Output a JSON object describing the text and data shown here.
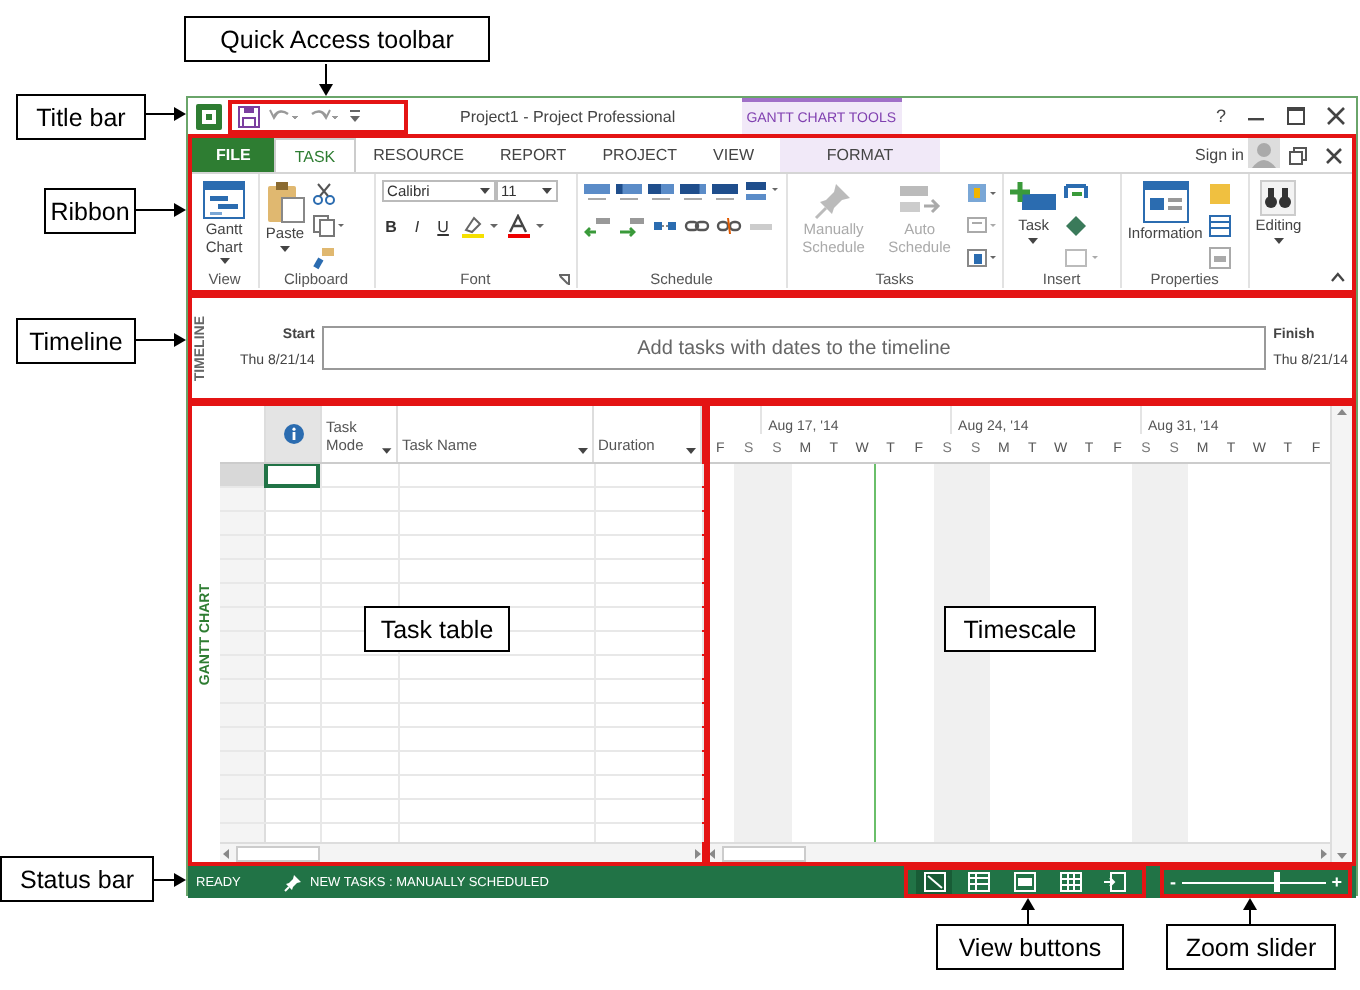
{
  "callouts": {
    "quick_access": "Quick Access toolbar",
    "title_bar": "Title bar",
    "ribbon": "Ribbon",
    "timeline": "Timeline",
    "task_table": "Task table",
    "timescale": "Timescale",
    "status_bar": "Status bar",
    "view_buttons": "View buttons",
    "zoom_slider": "Zoom slider"
  },
  "title_bar": {
    "title": "Project1 - Project Professional",
    "context_tab": "GANTT CHART TOOLS",
    "help": "?"
  },
  "ribbon_tabs": [
    {
      "label": "FILE",
      "kind": "file",
      "selected": false
    },
    {
      "label": "TASK",
      "kind": "tab",
      "selected": true
    },
    {
      "label": "RESOURCE",
      "kind": "tab",
      "selected": false
    },
    {
      "label": "REPORT",
      "kind": "tab",
      "selected": false
    },
    {
      "label": "PROJECT",
      "kind": "tab",
      "selected": false
    },
    {
      "label": "VIEW",
      "kind": "tab",
      "selected": false
    },
    {
      "label": "FORMAT",
      "kind": "context",
      "selected": false
    }
  ],
  "sign_in": "Sign in",
  "ribbon_groups": [
    {
      "kind": "view",
      "name": "View",
      "buttons": [
        {
          "label": "Gantt Chart",
          "disabled": false
        }
      ]
    },
    {
      "kind": "clipboard",
      "name": "Clipboard",
      "buttons": [
        {
          "label": "Paste",
          "disabled": false
        }
      ]
    },
    {
      "kind": "font",
      "name": "Font",
      "font": "Calibri",
      "size": "11",
      "styles": [
        "B",
        "I",
        "U"
      ]
    },
    {
      "kind": "schedule",
      "name": "Schedule"
    },
    {
      "kind": "tasks",
      "name": "Tasks",
      "buttons": [
        {
          "label": "Manually Schedule",
          "disabled": true
        },
        {
          "label": "Auto Schedule",
          "disabled": true
        }
      ]
    },
    {
      "kind": "insert",
      "name": "Insert",
      "buttons": [
        {
          "label": "Task",
          "disabled": false
        }
      ]
    },
    {
      "kind": "properties",
      "name": "Properties",
      "buttons": [
        {
          "label": "Information",
          "disabled": false
        }
      ]
    },
    {
      "kind": "editing",
      "buttons": [
        {
          "label": "Editing",
          "disabled": false
        }
      ]
    }
  ],
  "timeline": {
    "side_label": "TIMELINE",
    "start_label": "Start",
    "start_date": "Thu 8/21/14",
    "placeholder": "Add tasks with dates to the timeline",
    "finish_label": "Finish",
    "finish_date": "Thu 8/21/14"
  },
  "gantt": {
    "side_label": "GANTT CHART",
    "columns": [
      {
        "kind": "info"
      },
      {
        "kind": "text",
        "label": "Task Mode"
      },
      {
        "kind": "text",
        "label": "Task Name"
      },
      {
        "kind": "text",
        "label": "Duration"
      }
    ],
    "weeks": [
      "Aug 17, '14",
      "Aug 24, '14",
      "Aug 31, '14"
    ],
    "days": [
      {
        "label": "F",
        "weekend": false
      },
      {
        "label": "S",
        "weekend": true
      },
      {
        "label": "S",
        "weekend": true
      },
      {
        "label": "M",
        "weekend": false
      },
      {
        "label": "T",
        "weekend": false
      },
      {
        "label": "W",
        "weekend": false
      },
      {
        "label": "T",
        "weekend": false
      },
      {
        "label": "F",
        "weekend": false
      },
      {
        "label": "S",
        "weekend": true
      },
      {
        "label": "S",
        "weekend": true
      },
      {
        "label": "M",
        "weekend": false
      },
      {
        "label": "T",
        "weekend": false
      },
      {
        "label": "W",
        "weekend": false
      },
      {
        "label": "T",
        "weekend": false
      },
      {
        "label": "F",
        "weekend": false
      },
      {
        "label": "S",
        "weekend": true
      },
      {
        "label": "S",
        "weekend": true
      },
      {
        "label": "M",
        "weekend": false
      },
      {
        "label": "T",
        "weekend": false
      },
      {
        "label": "W",
        "weekend": false
      },
      {
        "label": "T",
        "weekend": false
      },
      {
        "label": "F",
        "weekend": false
      }
    ]
  },
  "status_bar": {
    "ready": "READY",
    "new_tasks": "NEW TASKS : MANUALLY SCHEDULED",
    "views": [
      {
        "selected": true
      },
      {
        "selected": false
      },
      {
        "selected": false
      },
      {
        "selected": false
      },
      {
        "selected": false
      }
    ],
    "zoom": {
      "minus": "-",
      "plus": "+",
      "level": 0.65
    }
  }
}
